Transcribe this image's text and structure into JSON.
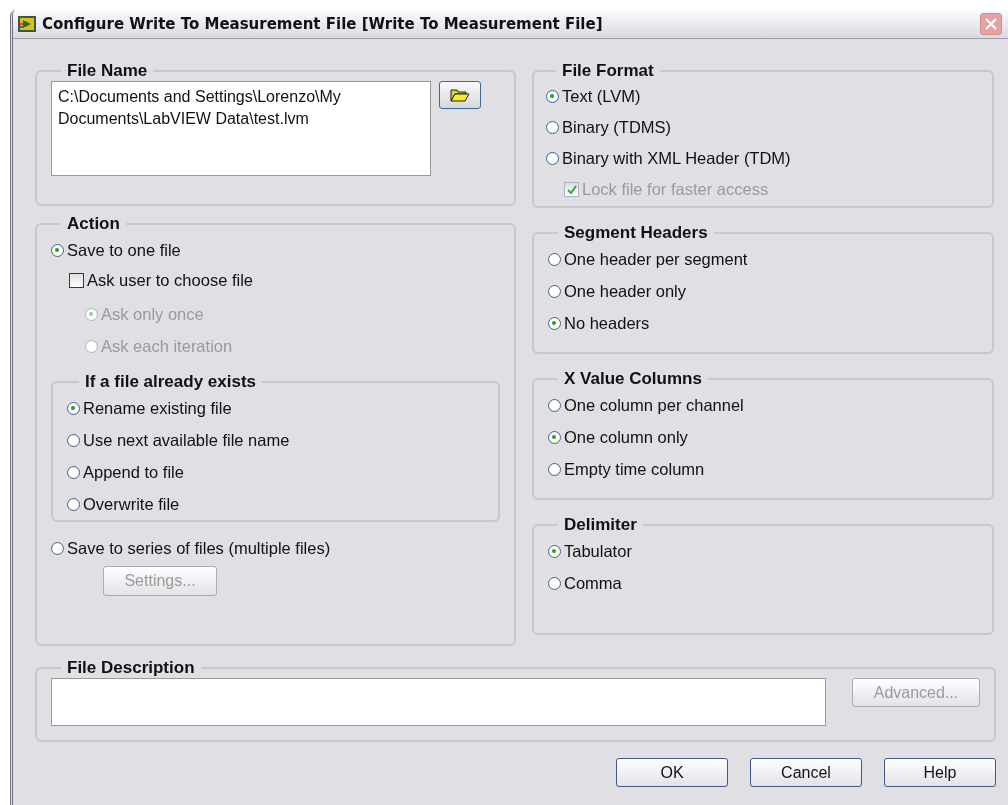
{
  "window": {
    "title": "Configure Write To Measurement File [Write To Measurement File]"
  },
  "file_name": {
    "title": "File Name",
    "value": "C:\\Documents and Settings\\Lorenzo\\My Documents\\LabVIEW Data\\test.lvm"
  },
  "action": {
    "title": "Action",
    "save_one": {
      "label": "Save to one file",
      "selected": true
    },
    "ask_user": {
      "label": "Ask user to choose file",
      "checked": false
    },
    "ask_options": [
      {
        "label": "Ask only once",
        "selected": true,
        "disabled": true
      },
      {
        "label": "Ask each iteration",
        "selected": false,
        "disabled": true
      }
    ],
    "exists": {
      "title": "If a file already exists",
      "options": [
        {
          "label": "Rename existing file",
          "selected": true
        },
        {
          "label": "Use next available file name",
          "selected": false
        },
        {
          "label": "Append to file",
          "selected": false
        },
        {
          "label": "Overwrite file",
          "selected": false
        }
      ]
    },
    "save_series": {
      "label": "Save to series of files (multiple files)",
      "selected": false
    },
    "settings_button": {
      "label": "Settings...",
      "disabled": true
    }
  },
  "file_format": {
    "title": "File Format",
    "options": [
      {
        "label": "Text (LVM)",
        "selected": true
      },
      {
        "label": "Binary (TDMS)",
        "selected": false
      },
      {
        "label": "Binary with XML Header (TDM)",
        "selected": false
      }
    ],
    "lock": {
      "label": "Lock file for faster access",
      "checked": true,
      "disabled": true
    }
  },
  "segment_headers": {
    "title": "Segment Headers",
    "options": [
      {
        "label": "One header per segment",
        "selected": false
      },
      {
        "label": "One header only",
        "selected": false
      },
      {
        "label": "No headers",
        "selected": true
      }
    ]
  },
  "x_value_columns": {
    "title": "X Value Columns",
    "options": [
      {
        "label": "One column per channel",
        "selected": false
      },
      {
        "label": "One column only",
        "selected": true
      },
      {
        "label": "Empty time column",
        "selected": false
      }
    ]
  },
  "delimiter": {
    "title": "Delimiter",
    "options": [
      {
        "label": "Tabulator",
        "selected": true
      },
      {
        "label": "Comma",
        "selected": false
      }
    ]
  },
  "file_description": {
    "title": "File Description"
  },
  "advanced_button": {
    "label": "Advanced...",
    "disabled": true
  },
  "buttons": [
    {
      "label": "OK"
    },
    {
      "label": "Cancel"
    },
    {
      "label": "Help"
    }
  ]
}
